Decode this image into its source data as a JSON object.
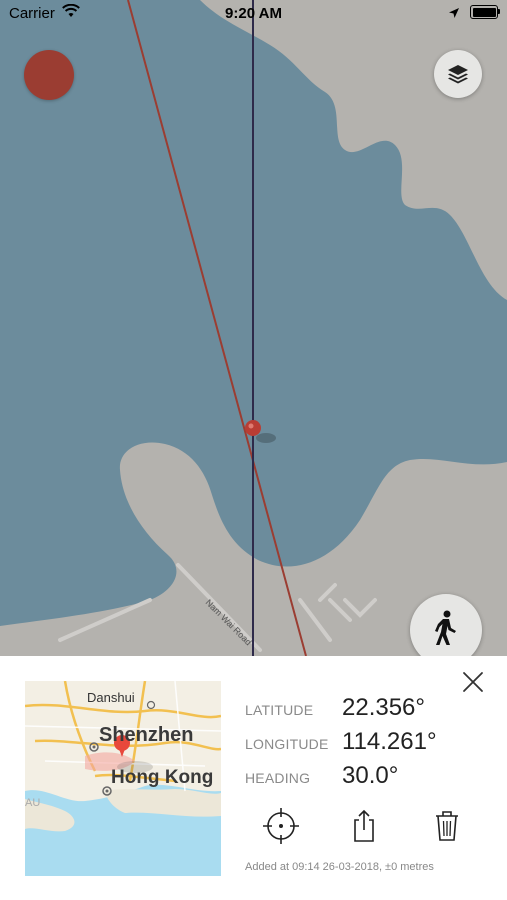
{
  "status_bar": {
    "carrier": "Carrier",
    "time": "9:20 AM"
  },
  "map": {
    "road_label": "Nam Wai Road",
    "colors": {
      "water": "#6c8c9c",
      "land": "#b4b2ae",
      "bearing_line": "#9b3d32",
      "north_line": "#2e2a4a",
      "pin": "#b93d34"
    }
  },
  "controls": {
    "record_icon": "record-dot",
    "layers_icon": "layers-icon",
    "mode_icon": "walking-person-icon"
  },
  "detail": {
    "thumbnail": {
      "labels": [
        "Danshui",
        "Shenzhen",
        "Hong Kong",
        "AU"
      ]
    },
    "latitude_label": "LATITUDE",
    "latitude_value": "22.356°",
    "longitude_label": "LONGITUDE",
    "longitude_value": "114.261°",
    "heading_label": "HEADING",
    "heading_value": "30.0°",
    "added_text": "Added at 09:14 26-03-2018, ±0 metres",
    "actions": [
      "crosshair-icon",
      "share-icon",
      "trash-icon"
    ],
    "close_icon": "close-icon"
  }
}
